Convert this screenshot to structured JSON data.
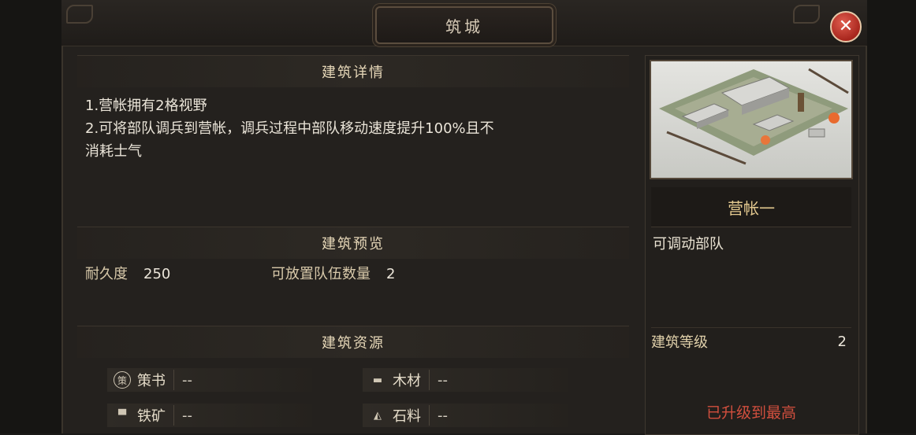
{
  "window": {
    "title": "筑城",
    "close_symbol": "✕"
  },
  "details": {
    "header": "建筑详情",
    "lines": [
      "1.营帐拥有2格视野",
      "2.可将部队调兵到营帐，调兵过程中部队移动速度提升100%且不",
      "消耗士气"
    ]
  },
  "preview": {
    "header": "建筑预览",
    "durability_label": "耐久度",
    "durability_value": "250",
    "capacity_label": "可放置队伍数量",
    "capacity_value": "2"
  },
  "resources": {
    "header": "建筑资源",
    "items": [
      {
        "icon": "strategy-book-icon",
        "glyph": "策",
        "name": "策书",
        "amount": "--"
      },
      {
        "icon": "wood-icon",
        "glyph": "▬",
        "name": "木材",
        "amount": "--"
      },
      {
        "icon": "iron-ore-icon",
        "glyph": "▀",
        "name": "铁矿",
        "amount": "--"
      },
      {
        "icon": "stone-icon",
        "glyph": "◭",
        "name": "石料",
        "amount": "--"
      }
    ]
  },
  "building": {
    "name": "营帐一",
    "description": "可调动部队",
    "level_label": "建筑等级",
    "level_value": "2",
    "status": "已升级到最高"
  },
  "colors": {
    "accent_gold": "#e4c98f",
    "status_red": "#d24f3e",
    "close_red": "#c0392b"
  }
}
